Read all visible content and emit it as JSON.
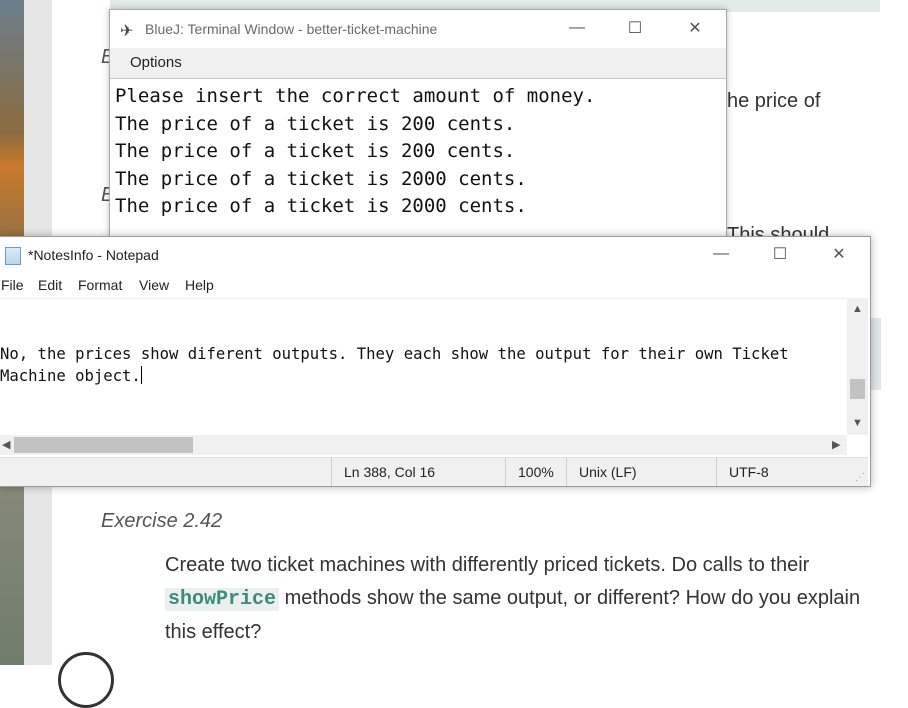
{
  "background": {
    "frag_top_right": "he price of",
    "frag_mid_right": "This should",
    "frag_left_1": "E",
    "frag_left_2": "E",
    "exercise_heading": "Exercise 2.42",
    "exercise_text_1": "Create two ticket machines with differently priced tickets. Do calls to their",
    "exercise_code": "showPrice",
    "exercise_text_2": " methods show the same output, or different? How do you explain this effect?"
  },
  "bluej": {
    "title": "BlueJ: Terminal Window - better-ticket-machine",
    "menu_options": "Options",
    "output_lines": [
      "Please insert the correct amount of money.",
      "The price of a ticket is 200 cents.",
      "The price of a ticket is 200 cents.",
      "The price of a ticket is 2000 cents.",
      "The price of a ticket is 2000 cents."
    ],
    "icon": "bluej-bird-icon"
  },
  "notepad": {
    "title": "*NotesInfo - Notepad",
    "menu": [
      "File",
      "Edit",
      "Format",
      "View",
      "Help"
    ],
    "text_line_1": "No, the prices show diferent outputs. They each show the output for their own Ticket",
    "text_line_2": "Machine object.",
    "status": {
      "position": "Ln 388, Col 16",
      "zoom": "100%",
      "line_ending": "Unix (LF)",
      "encoding": "UTF-8"
    },
    "icon": "notepad-icon"
  },
  "controls": {
    "minimize": "—",
    "maximize": "☐",
    "close": "✕"
  }
}
